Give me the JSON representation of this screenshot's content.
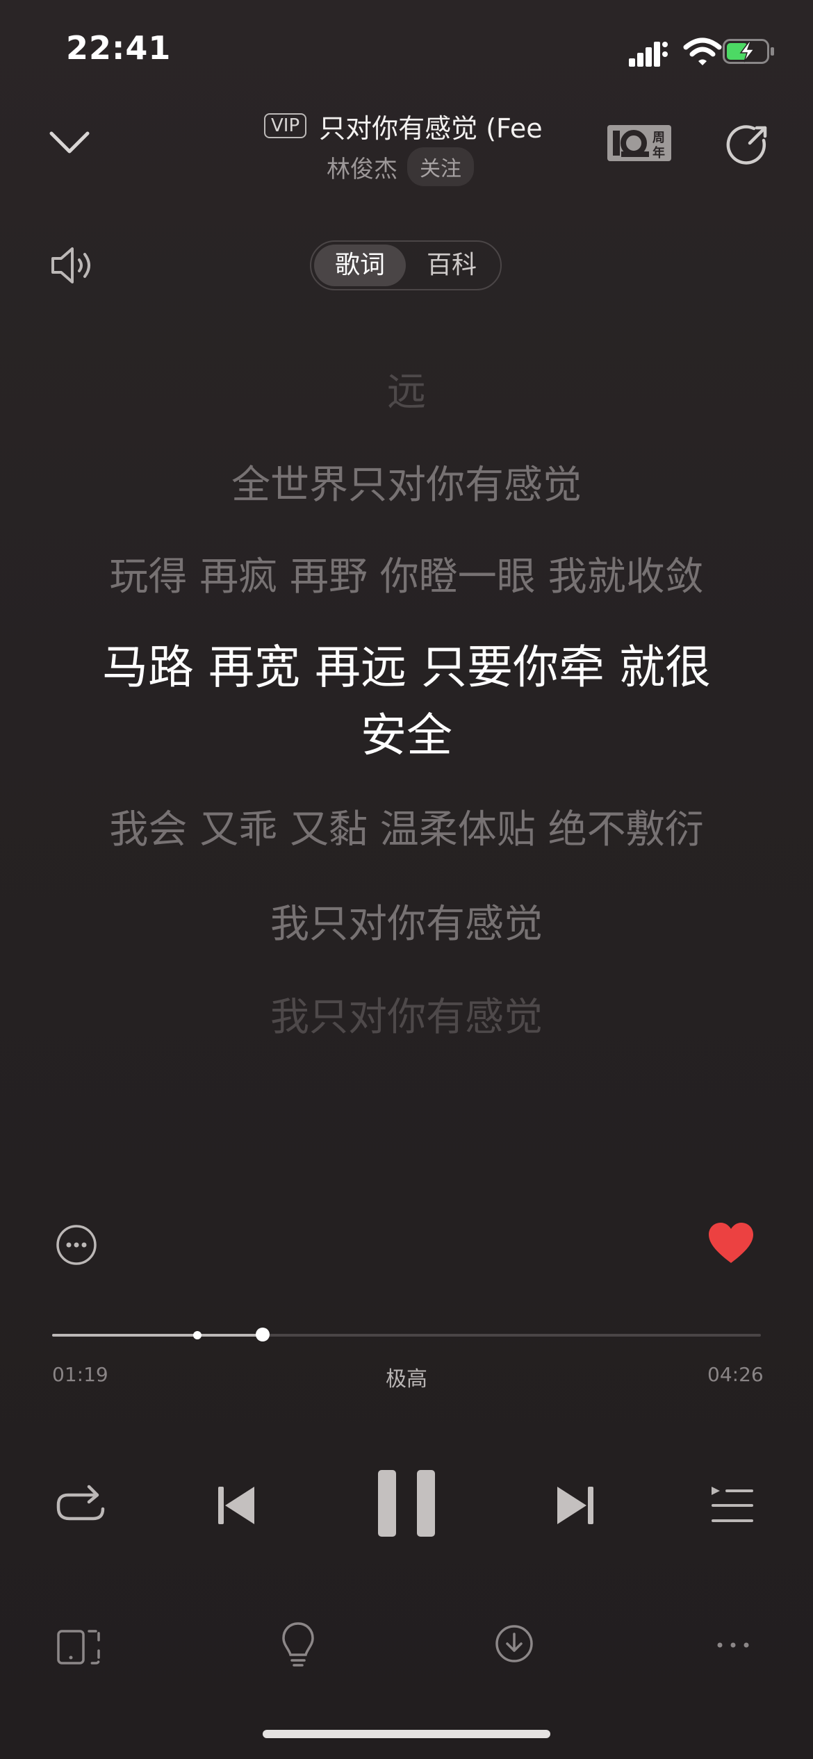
{
  "status_bar": {
    "time": "22:41"
  },
  "header": {
    "vip_badge": "VIP",
    "song_title": "只对你有感觉 (Fee",
    "artist": "林俊杰",
    "follow_label": "关注"
  },
  "tabs": [
    {
      "label": "歌词",
      "active": true
    },
    {
      "label": "百科",
      "active": false
    }
  ],
  "lyrics": [
    "远",
    "全世界只对你有感觉",
    "玩得 再疯 再野 你瞪一眼 我就收敛",
    "马路 再宽 再远 只要你牵 就很安全",
    "我会 又乖 又黏 温柔体贴 绝不敷衍",
    "我只对你有感觉",
    "我只对你有感觉"
  ],
  "current_lyric_index": 3,
  "player": {
    "current_time": "01:19",
    "total_time": "04:26",
    "quality": "极高",
    "progress_fraction": 0.297,
    "buffered_fraction": 0.297,
    "liked": true
  },
  "icons": {
    "collapse": "chevron-down-icon",
    "anniversary": "anniversary-badge-icon",
    "share": "share-icon",
    "volume": "speaker-icon",
    "more": "more-circle-icon",
    "like": "heart-icon",
    "repeat": "repeat-icon",
    "prev": "previous-icon",
    "pause": "pause-icon",
    "next": "next-icon",
    "playlist": "playlist-icon",
    "device": "device-icon",
    "bulb": "lightbulb-icon",
    "download": "download-icon",
    "more_dots": "more-dots-icon"
  },
  "colors": {
    "background": "#262223",
    "heart": "#ec4141",
    "battery_fill": "#4cd964"
  }
}
